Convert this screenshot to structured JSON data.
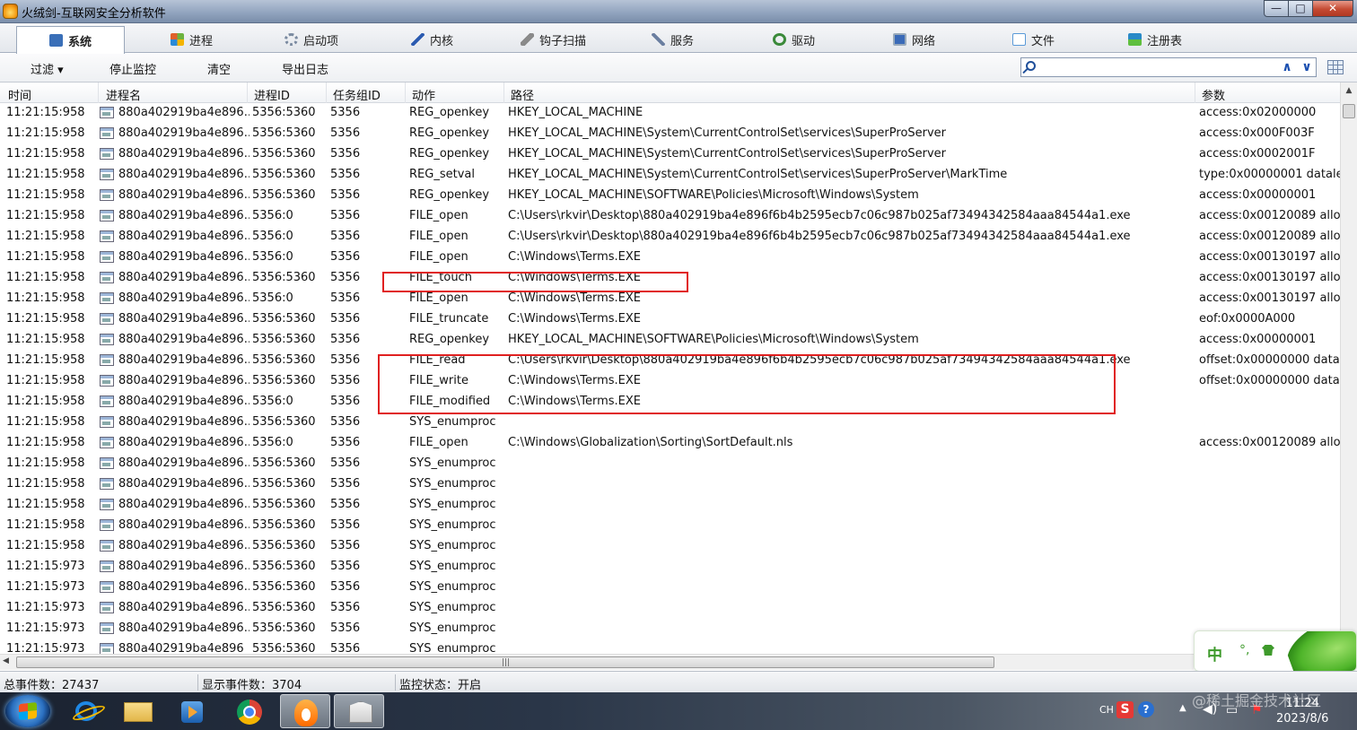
{
  "window": {
    "title": "火绒剑-互联网安全分析软件",
    "controls": [
      "—",
      "□",
      "✕"
    ]
  },
  "tabs": [
    {
      "label": "系统",
      "icon": "monitor-icon",
      "color": "#3a6fb8"
    },
    {
      "label": "进程",
      "icon": "windows-flag-icon",
      "color": "#e0602a"
    },
    {
      "label": "启动项",
      "icon": "gear-icon",
      "color": "#7a8aa0"
    },
    {
      "label": "内核",
      "icon": "pen-icon",
      "color": "#2a5ab0"
    },
    {
      "label": "钩子扫描",
      "icon": "hook-icon",
      "color": "#8a8a8a"
    },
    {
      "label": "服务",
      "icon": "wrench-icon",
      "color": "#6a7ea0"
    },
    {
      "label": "驱动",
      "icon": "driver-gear-icon",
      "color": "#3b8a3b"
    },
    {
      "label": "网络",
      "icon": "network-icon",
      "color": "#3a6ab8"
    },
    {
      "label": "文件",
      "icon": "file-icon",
      "color": "#5a9ad8"
    },
    {
      "label": "注册表",
      "icon": "registry-icon",
      "color": "#2a8ac8"
    }
  ],
  "toolbar": {
    "filter_label": "过滤 ▾",
    "stop_label": "停止监控",
    "clear_label": "清空",
    "export_label": "导出日志",
    "search_value": "",
    "search_placeholder": ""
  },
  "columns": [
    "时间",
    "进程名",
    "进程ID",
    "任务组ID",
    "动作",
    "路径",
    "参数"
  ],
  "rows": [
    {
      "time": "11:21:15:958",
      "proc": "880a402919ba4e896...",
      "pid": "5356:5360",
      "tgid": "5356",
      "action": "REG_openkey",
      "path": "HKEY_LOCAL_MACHINE",
      "param": "access:0x02000000"
    },
    {
      "time": "11:21:15:958",
      "proc": "880a402919ba4e896...",
      "pid": "5356:5360",
      "tgid": "5356",
      "action": "REG_openkey",
      "path": "HKEY_LOCAL_MACHINE\\System\\CurrentControlSet\\services\\SuperProServer",
      "param": "access:0x000F003F"
    },
    {
      "time": "11:21:15:958",
      "proc": "880a402919ba4e896...",
      "pid": "5356:5360",
      "tgid": "5356",
      "action": "REG_openkey",
      "path": "HKEY_LOCAL_MACHINE\\System\\CurrentControlSet\\services\\SuperProServer",
      "param": "access:0x0002001F"
    },
    {
      "time": "11:21:15:958",
      "proc": "880a402919ba4e896...",
      "pid": "5356:5360",
      "tgid": "5356",
      "action": "REG_setval",
      "path": "HKEY_LOCAL_MACHINE\\System\\CurrentControlSet\\services\\SuperProServer\\MarkTime",
      "param": "type:0x00000001 datalen"
    },
    {
      "time": "11:21:15:958",
      "proc": "880a402919ba4e896...",
      "pid": "5356:5360",
      "tgid": "5356",
      "action": "REG_openkey",
      "path": "HKEY_LOCAL_MACHINE\\SOFTWARE\\Policies\\Microsoft\\Windows\\System",
      "param": "access:0x00000001"
    },
    {
      "time": "11:21:15:958",
      "proc": "880a402919ba4e896...",
      "pid": "5356:0",
      "tgid": "5356",
      "action": "FILE_open",
      "path": "C:\\Users\\rkvir\\Desktop\\880a402919ba4e896f6b4b2595ecb7c06c987b025af73494342584aaa84544a1.exe",
      "param": "access:0x00120089 alloc"
    },
    {
      "time": "11:21:15:958",
      "proc": "880a402919ba4e896...",
      "pid": "5356:0",
      "tgid": "5356",
      "action": "FILE_open",
      "path": "C:\\Users\\rkvir\\Desktop\\880a402919ba4e896f6b4b2595ecb7c06c987b025af73494342584aaa84544a1.exe",
      "param": "access:0x00120089 alloc"
    },
    {
      "time": "11:21:15:958",
      "proc": "880a402919ba4e896...",
      "pid": "5356:0",
      "tgid": "5356",
      "action": "FILE_open",
      "path": "C:\\Windows\\Terms.EXE",
      "param": "access:0x00130197 alloc"
    },
    {
      "time": "11:21:15:958",
      "proc": "880a402919ba4e896...",
      "pid": "5356:5360",
      "tgid": "5356",
      "action": "FILE_touch",
      "path": "C:\\Windows\\Terms.EXE",
      "param": "access:0x00130197 alloc"
    },
    {
      "time": "11:21:15:958",
      "proc": "880a402919ba4e896...",
      "pid": "5356:0",
      "tgid": "5356",
      "action": "FILE_open",
      "path": "C:\\Windows\\Terms.EXE",
      "param": "access:0x00130197 alloc"
    },
    {
      "time": "11:21:15:958",
      "proc": "880a402919ba4e896...",
      "pid": "5356:5360",
      "tgid": "5356",
      "action": "FILE_truncate",
      "path": "C:\\Windows\\Terms.EXE",
      "param": "eof:0x0000A000"
    },
    {
      "time": "11:21:15:958",
      "proc": "880a402919ba4e896...",
      "pid": "5356:5360",
      "tgid": "5356",
      "action": "REG_openkey",
      "path": "HKEY_LOCAL_MACHINE\\SOFTWARE\\Policies\\Microsoft\\Windows\\System",
      "param": "access:0x00000001"
    },
    {
      "time": "11:21:15:958",
      "proc": "880a402919ba4e896...",
      "pid": "5356:5360",
      "tgid": "5356",
      "action": "FILE_read",
      "path": "C:\\Users\\rkvir\\Desktop\\880a402919ba4e896f6b4b2595ecb7c06c987b025af73494342584aaa84544a1.exe",
      "param": "offset:0x00000000 datale"
    },
    {
      "time": "11:21:15:958",
      "proc": "880a402919ba4e896...",
      "pid": "5356:5360",
      "tgid": "5356",
      "action": "FILE_write",
      "path": "C:\\Windows\\Terms.EXE",
      "param": "offset:0x00000000 datale"
    },
    {
      "time": "11:21:15:958",
      "proc": "880a402919ba4e896...",
      "pid": "5356:0",
      "tgid": "5356",
      "action": "FILE_modified",
      "path": "C:\\Windows\\Terms.EXE",
      "param": ""
    },
    {
      "time": "11:21:15:958",
      "proc": "880a402919ba4e896...",
      "pid": "5356:5360",
      "tgid": "5356",
      "action": "SYS_enumproc",
      "path": "",
      "param": ""
    },
    {
      "time": "11:21:15:958",
      "proc": "880a402919ba4e896...",
      "pid": "5356:0",
      "tgid": "5356",
      "action": "FILE_open",
      "path": "C:\\Windows\\Globalization\\Sorting\\SortDefault.nls",
      "param": "access:0x00120089 alloc"
    },
    {
      "time": "11:21:15:958",
      "proc": "880a402919ba4e896...",
      "pid": "5356:5360",
      "tgid": "5356",
      "action": "SYS_enumproc",
      "path": "",
      "param": ""
    },
    {
      "time": "11:21:15:958",
      "proc": "880a402919ba4e896...",
      "pid": "5356:5360",
      "tgid": "5356",
      "action": "SYS_enumproc",
      "path": "",
      "param": ""
    },
    {
      "time": "11:21:15:958",
      "proc": "880a402919ba4e896...",
      "pid": "5356:5360",
      "tgid": "5356",
      "action": "SYS_enumproc",
      "path": "",
      "param": ""
    },
    {
      "time": "11:21:15:958",
      "proc": "880a402919ba4e896...",
      "pid": "5356:5360",
      "tgid": "5356",
      "action": "SYS_enumproc",
      "path": "",
      "param": ""
    },
    {
      "time": "11:21:15:958",
      "proc": "880a402919ba4e896...",
      "pid": "5356:5360",
      "tgid": "5356",
      "action": "SYS_enumproc",
      "path": "",
      "param": ""
    },
    {
      "time": "11:21:15:973",
      "proc": "880a402919ba4e896...",
      "pid": "5356:5360",
      "tgid": "5356",
      "action": "SYS_enumproc",
      "path": "",
      "param": ""
    },
    {
      "time": "11:21:15:973",
      "proc": "880a402919ba4e896...",
      "pid": "5356:5360",
      "tgid": "5356",
      "action": "SYS_enumproc",
      "path": "",
      "param": ""
    },
    {
      "time": "11:21:15:973",
      "proc": "880a402919ba4e896...",
      "pid": "5356:5360",
      "tgid": "5356",
      "action": "SYS_enumproc",
      "path": "",
      "param": ""
    },
    {
      "time": "11:21:15:973",
      "proc": "880a402919ba4e896...",
      "pid": "5356:5360",
      "tgid": "5356",
      "action": "SYS_enumproc",
      "path": "",
      "param": ""
    },
    {
      "time": "11:21:15:973",
      "proc": "880a402919ba4e896",
      "pid": "5356:5360",
      "tgid": "5356",
      "action": "SYS_enumproc",
      "path": "",
      "param": ""
    }
  ],
  "status": {
    "total": "总事件数：27437",
    "shown": "显示事件数：3704",
    "monitor": "监控状态：开启"
  },
  "ime": {
    "mode": "中",
    "punct": "°,"
  },
  "taskbar": {
    "items": [
      "start-orb-icon",
      "internet-explorer-icon",
      "file-explorer-icon",
      "media-player-icon",
      "chrome-icon",
      "huorong-icon",
      "huorong-sword-icon"
    ],
    "tray_lang": "CH",
    "tray_s": "S",
    "tray_help": "?",
    "clock_time": "11:24",
    "clock_date": "2023/8/6"
  },
  "watermark": "@稀土掘金技术社区"
}
